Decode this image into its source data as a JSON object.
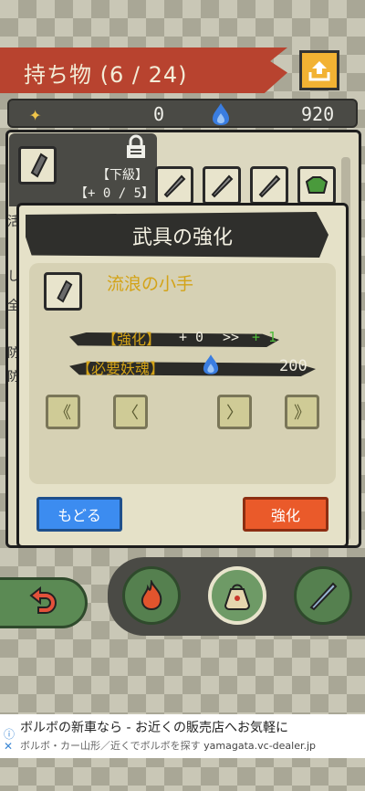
{
  "header": {
    "title": "持ち物 (6 / 24)"
  },
  "currency": {
    "gold": "0",
    "souls": "920"
  },
  "inventory": {
    "grade_line1": "【下級】",
    "grade_line2": "【+ 0 / 5】",
    "side_chars": [
      "活",
      "し",
      "全",
      "防",
      "防"
    ]
  },
  "dialog": {
    "title": "武具の強化",
    "item_name": "流浪の小手",
    "upgrade_label": "【強化】",
    "upgrade_current": "+ 0",
    "upgrade_arrow": ">>",
    "upgrade_next": "+ 1",
    "cost_label": "【必要妖魂】",
    "cost_value": "200",
    "nav": {
      "first": "《",
      "prev": "〈",
      "next": "〉",
      "last": "》"
    },
    "back_label": "もどる",
    "confirm_label": "強化"
  },
  "ad": {
    "title": "ボルボの新車なら - お近くの販売店へお気軽に",
    "subtitle": "ボルボ・カー山形／近くでボルボを探す",
    "domain": "yamagata.vc-dealer.jp"
  },
  "colors": {
    "header_red": "#b8432f",
    "gold_text": "#d3a317",
    "green_text": "#4fbb3a",
    "back_button": "#3c8cf0",
    "confirm_button": "#ea5a2a"
  }
}
